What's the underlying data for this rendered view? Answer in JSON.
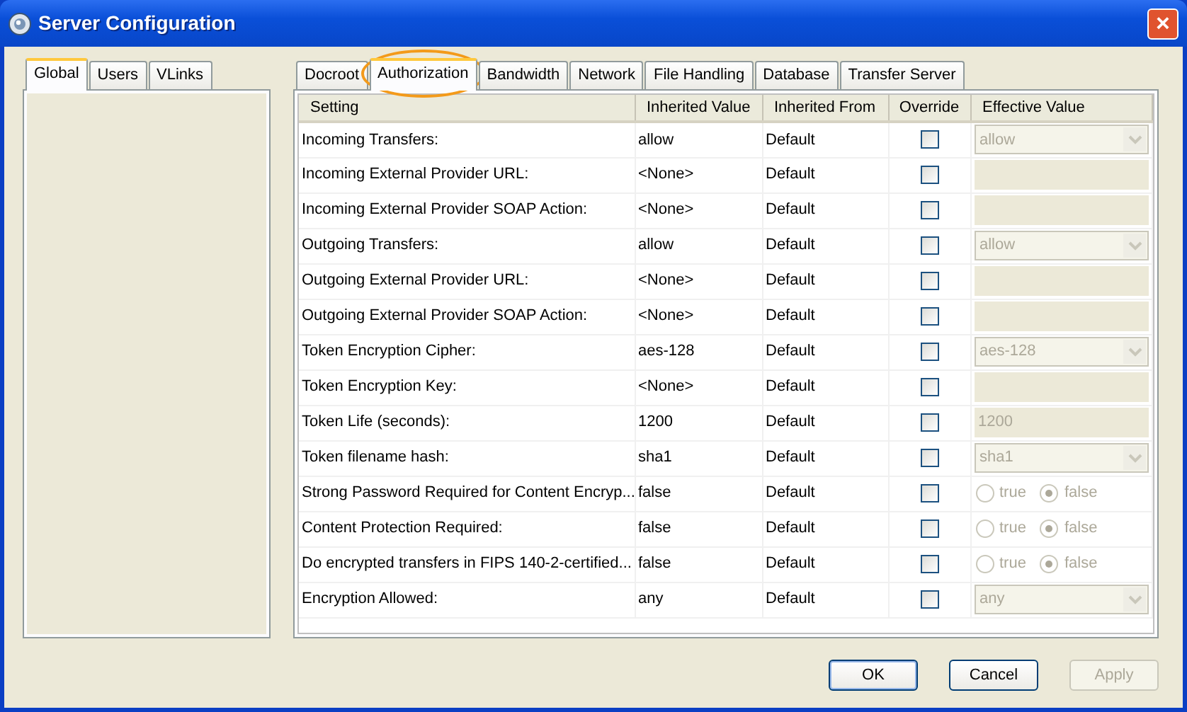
{
  "window": {
    "title": "Server Configuration",
    "close": "×"
  },
  "left_tabs": [
    {
      "label": "Global",
      "selected": true
    },
    {
      "label": "Users",
      "selected": false
    },
    {
      "label": "VLinks",
      "selected": false
    }
  ],
  "tabs": [
    {
      "label": "Docroot",
      "selected": false,
      "highlighted": false
    },
    {
      "label": "Authorization",
      "selected": true,
      "highlighted": true
    },
    {
      "label": "Bandwidth",
      "selected": false,
      "highlighted": false
    },
    {
      "label": "Network",
      "selected": false,
      "highlighted": false
    },
    {
      "label": "File Handling",
      "selected": false,
      "highlighted": false
    },
    {
      "label": "Database",
      "selected": false,
      "highlighted": false
    },
    {
      "label": "Transfer Server",
      "selected": false,
      "highlighted": false
    }
  ],
  "table": {
    "columns": [
      "Setting",
      "Inherited Value",
      "Inherited From",
      "Override",
      "Effective Value"
    ],
    "rows": [
      {
        "setting": "Incoming Transfers:",
        "inherited_value": "allow",
        "inherited_from": "Default",
        "override": false,
        "effective": {
          "kind": "select",
          "value": "allow"
        }
      },
      {
        "setting": "Incoming External Provider URL:",
        "inherited_value": "<None>",
        "inherited_from": "Default",
        "override": false,
        "effective": {
          "kind": "text"
        }
      },
      {
        "setting": "Incoming External Provider SOAP Action:",
        "inherited_value": "<None>",
        "inherited_from": "Default",
        "override": false,
        "effective": {
          "kind": "text"
        }
      },
      {
        "setting": "Outgoing Transfers:",
        "inherited_value": "allow",
        "inherited_from": "Default",
        "override": false,
        "effective": {
          "kind": "select",
          "value": "allow"
        }
      },
      {
        "setting": "Outgoing External Provider URL:",
        "inherited_value": "<None>",
        "inherited_from": "Default",
        "override": false,
        "effective": {
          "kind": "text"
        }
      },
      {
        "setting": "Outgoing External Provider SOAP Action:",
        "inherited_value": "<None>",
        "inherited_from": "Default",
        "override": false,
        "effective": {
          "kind": "text"
        }
      },
      {
        "setting": "Token Encryption Cipher:",
        "inherited_value": "aes-128",
        "inherited_from": "Default",
        "override": false,
        "effective": {
          "kind": "select",
          "value": "aes-128"
        }
      },
      {
        "setting": "Token Encryption Key:",
        "inherited_value": "<None>",
        "inherited_from": "Default",
        "override": false,
        "effective": {
          "kind": "text"
        }
      },
      {
        "setting": "Token Life (seconds):",
        "inherited_value": "1200",
        "inherited_from": "Default",
        "override": false,
        "effective": {
          "kind": "text",
          "value": "1200"
        }
      },
      {
        "setting": "Token filename hash:",
        "inherited_value": "sha1",
        "inherited_from": "Default",
        "override": false,
        "effective": {
          "kind": "select",
          "value": "sha1"
        }
      },
      {
        "setting": "Strong Password Required for Content Encryp...",
        "inherited_value": "false",
        "inherited_from": "Default",
        "override": false,
        "effective": {
          "kind": "radio",
          "options": [
            {
              "label": "true",
              "selected": false
            },
            {
              "label": "false",
              "selected": true
            }
          ]
        }
      },
      {
        "setting": "Content Protection Required:",
        "inherited_value": "false",
        "inherited_from": "Default",
        "override": false,
        "effective": {
          "kind": "radio",
          "options": [
            {
              "label": "true",
              "selected": false
            },
            {
              "label": "false",
              "selected": true
            }
          ]
        }
      },
      {
        "setting": "Do encrypted transfers in FIPS 140-2-certified...",
        "inherited_value": "false",
        "inherited_from": "Default",
        "override": false,
        "effective": {
          "kind": "radio",
          "options": [
            {
              "label": "true",
              "selected": false
            },
            {
              "label": "false",
              "selected": true
            }
          ]
        }
      },
      {
        "setting": "Encryption Allowed:",
        "inherited_value": "any",
        "inherited_from": "Default",
        "override": false,
        "effective": {
          "kind": "select",
          "value": "any"
        }
      }
    ]
  },
  "buttons": [
    {
      "label": "OK",
      "disabled": false,
      "default": true
    },
    {
      "label": "Cancel",
      "disabled": false,
      "default": false
    },
    {
      "label": "Apply",
      "disabled": true,
      "default": false
    }
  ]
}
